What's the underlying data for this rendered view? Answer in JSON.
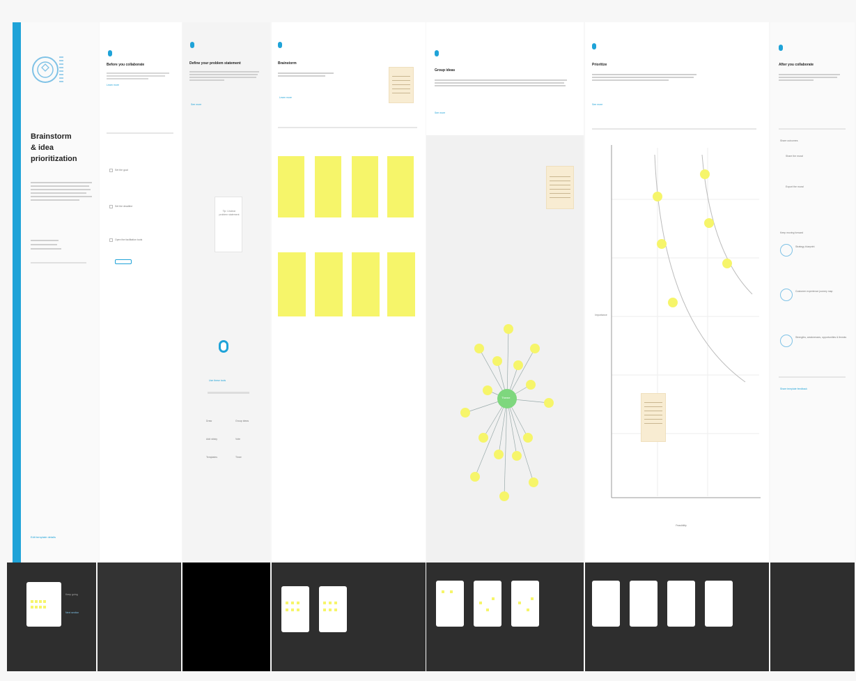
{
  "colors": {
    "accent": "#1fa3d8",
    "sticky": "#f6f56a",
    "center_node": "#7ed77e",
    "note": "#f8ecd2",
    "strip_dark": "#2e2e2e"
  },
  "intro": {
    "title_line1": "Brainstorm",
    "title_line2": "& idea prioritization",
    "link": "Edit template details"
  },
  "panels": {
    "p1": {
      "title": "Before you collaborate",
      "link": "Learn more",
      "items": [
        "Set the goal",
        "Set the deadline",
        "Open the facilitation tools"
      ]
    },
    "p2": {
      "title": "Define your problem statement",
      "link": "See more",
      "card": "Tip: Unclear problem statement",
      "tool_title": "Use these tools",
      "tools": [
        "Draw",
        "Group ideas",
        "Add sticky",
        "Vote",
        "Templates",
        "Timer"
      ]
    },
    "p3": {
      "title": "Brainstorm",
      "link": "Learn more"
    },
    "p4": {
      "title": "Group ideas",
      "link": "See more",
      "center": "Theme"
    },
    "p5": {
      "title": "Prioritize",
      "link": "See more",
      "y_label": "Importance",
      "x_label": "Feasibility"
    },
    "p6": {
      "title": "After you collaborate",
      "section1": "Share outcomes",
      "section2": "Keep moving forward",
      "items1": [
        "Share the mural",
        "Export the mural"
      ],
      "items2": [
        "Strategy blueprint",
        "Customer experience journey map",
        "Strengths, weaknesses, opportunities & threats"
      ],
      "footer_link": "Share template feedback"
    }
  },
  "strip": {
    "label": "Keep going",
    "button": "Next section"
  }
}
